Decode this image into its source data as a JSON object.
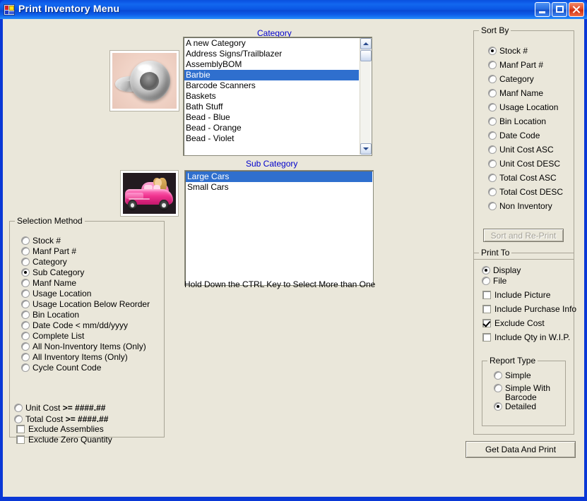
{
  "window": {
    "title": "Print Inventory Menu",
    "icon": "app-icon",
    "buttons": {
      "minimize": "minimize-icon",
      "maximize": "maximize-icon",
      "close": "close-icon"
    }
  },
  "category": {
    "label": "Category",
    "items": [
      "A new Category",
      "Address Signs/Trailblazer",
      "AssemblyBOM",
      "Barbie",
      "Barcode Scanners",
      "Baskets",
      "Bath Stuff",
      "Bead - Blue",
      "Bead - Orange",
      "Bead - Violet"
    ],
    "selected": "Barbie"
  },
  "sub_category": {
    "label": "Sub Category",
    "items": [
      "Large Cars",
      "Small Cars"
    ],
    "selected": "Large Cars",
    "hint": "Hold Down the CTRL Key to Select More than One"
  },
  "pictures": {
    "category_image_alt": "silver ring product photo",
    "sub_category_image_alt": "pink Barbie convertible car toy photo"
  },
  "sort_by": {
    "title": "Sort By",
    "options": [
      "Stock #",
      "Manf Part #",
      "Category",
      "Manf Name",
      "Usage Location",
      "Bin Location",
      "Date Code",
      "Unit Cost ASC",
      "Unit Cost DESC",
      "Total Cost ASC",
      "Total Cost DESC",
      "Non Inventory"
    ],
    "selected": "Stock #",
    "sort_button": "Sort and Re-Print",
    "sort_button_enabled": false
  },
  "selection_method": {
    "title": "Selection Method",
    "options": [
      "Stock #",
      "Manf Part #",
      "Category",
      "Sub Category",
      "Manf Name",
      "Usage Location",
      "Usage Location Below Reorder",
      "Bin Location",
      "Date Code <  mm/dd/yyyy",
      "Complete List",
      "All Non-Inventory Items (Only)",
      "All Inventory Items (Only)",
      "Cycle Count Code"
    ],
    "selected": "Sub Category",
    "cost_filters": [
      {
        "prefix": "Unit Cost",
        "op": ">= ####.##",
        "selected": false
      },
      {
        "prefix": "Total Cost",
        "op": ">= ####.##",
        "selected": false
      }
    ],
    "checkboxes": [
      {
        "label": "Exclude Assemblies",
        "checked": false
      },
      {
        "label": "Exclude Zero Quantity",
        "checked": false
      }
    ]
  },
  "print_to": {
    "title": "Print To",
    "options": [
      "Display",
      "File"
    ],
    "selected": "Display",
    "checkboxes": [
      {
        "label": "Include Picture",
        "checked": false
      },
      {
        "label": "Include Purchase Info",
        "checked": false
      },
      {
        "label": "Exclude Cost",
        "checked": true
      },
      {
        "label": "Include Qty in W.I.P.",
        "checked": false
      }
    ],
    "report_type": {
      "title": "Report Type",
      "options": [
        "Simple",
        "Simple With Barcode",
        "Detailed"
      ],
      "selected": "Detailed"
    }
  },
  "actions": {
    "get_data_and_print": "Get Data And Print"
  },
  "colors": {
    "titlebar_blue": "#0c57e6",
    "window_frame": "#0a38d6",
    "client_bg": "#eae7da",
    "heading_blue": "#0000cc",
    "selection_blue": "#2f6fce"
  }
}
